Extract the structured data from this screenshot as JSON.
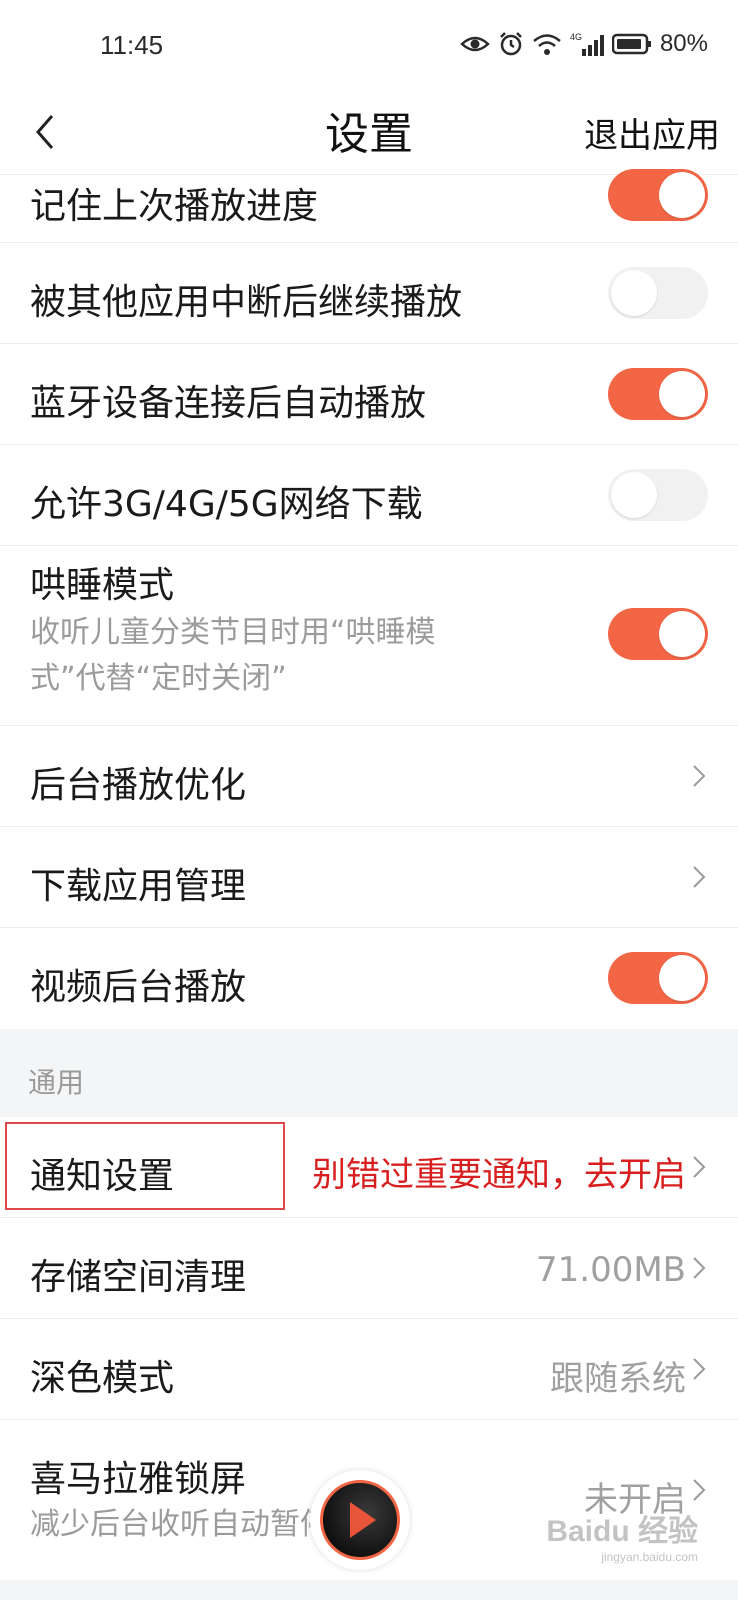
{
  "status_bar": {
    "time": "11:45",
    "battery": "80%",
    "network": "4G"
  },
  "header": {
    "title": "设置",
    "exit_label": "退出应用"
  },
  "rows_top": [
    {
      "label": "记住上次播放进度",
      "toggle": true
    },
    {
      "label": "被其他应用中断后继续播放",
      "toggle": false
    },
    {
      "label": "蓝牙设备连接后自动播放",
      "toggle": true
    },
    {
      "label": "允许3G/4G/5G网络下载",
      "toggle": false
    },
    {
      "label": "哄睡模式",
      "subtitle_line1": "收听儿童分类节目时用“哄睡模",
      "subtitle_line2": "式”代替“定时关闭”",
      "toggle": true
    },
    {
      "label": "后台播放优化"
    },
    {
      "label": "下载应用管理"
    },
    {
      "label": "视频后台播放",
      "toggle": true
    }
  ],
  "section_general": {
    "title": "通用"
  },
  "rows_general": [
    {
      "label": "通知设置",
      "annotation": "别错过重要通知，去开启"
    },
    {
      "label": "存储空间清理",
      "value": "71.00MB"
    },
    {
      "label": "深色模式",
      "value": "跟随系统"
    },
    {
      "label": "喜马拉雅锁屏",
      "value": "未开启",
      "subtitle": "减少后台收听自动暂停现象"
    }
  ],
  "watermark": {
    "main": "Baidu 经验",
    "sub": "jingyan.baidu.com"
  },
  "colors": {
    "accent": "#f26545",
    "annotation": "#d71f1f",
    "background": "#f4f5f7"
  }
}
